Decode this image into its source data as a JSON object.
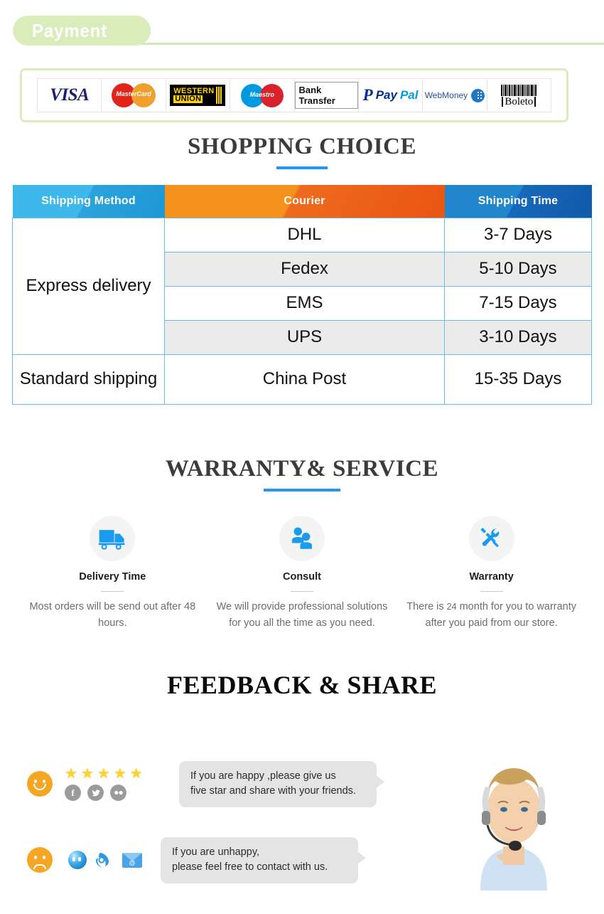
{
  "payment": {
    "banner_label": "Payment",
    "methods": [
      {
        "name": "visa",
        "label": "VISA"
      },
      {
        "name": "mastercard",
        "label": "MasterCard"
      },
      {
        "name": "western-union",
        "label_line1": "WESTERN",
        "label_line2": "UNION"
      },
      {
        "name": "maestro",
        "label": "Maestro"
      },
      {
        "name": "bank-transfer",
        "label": "Bank Transfer"
      },
      {
        "name": "paypal",
        "label_pay": "Pay",
        "label_pal": "Pal"
      },
      {
        "name": "webmoney",
        "label": "WebMoney"
      },
      {
        "name": "boleto",
        "label": "Boleto"
      }
    ]
  },
  "shipping": {
    "title": "SHOPPING CHOICE",
    "columns": [
      "Shipping Method",
      "Courier",
      "Shipping Time"
    ],
    "groups": [
      {
        "method": "Express delivery",
        "rows": [
          {
            "courier": "DHL",
            "time": "3-7  Days"
          },
          {
            "courier": "Fedex",
            "time": "5-10 Days"
          },
          {
            "courier": "EMS",
            "time": "7-15 Days"
          },
          {
            "courier": "UPS",
            "time": "3-10 Days"
          }
        ]
      },
      {
        "method": "Standard shipping",
        "rows": [
          {
            "courier": "China Post",
            "time": "15-35 Days"
          }
        ]
      }
    ]
  },
  "warranty": {
    "title": "WARRANTY& SERVICE",
    "items": [
      {
        "icon": "delivery-truck-icon",
        "name": "Delivery Time",
        "desc": "Most orders will be send out after 48 hours."
      },
      {
        "icon": "consult-people-icon",
        "name": "Consult",
        "desc": "We will provide professional solutions for you all the time as you need."
      },
      {
        "icon": "tools-icon",
        "name": "Warranty",
        "desc_pre": "There is ",
        "desc_num": "24",
        "desc_post": " month for you to warranty after you paid from our store."
      }
    ]
  },
  "feedback": {
    "title": "FEEDBACK & SHARE",
    "happy": {
      "face": "smiley-happy-icon",
      "star_count": 5,
      "star_glyph": "★",
      "socials": [
        {
          "name": "facebook-icon",
          "glyph": "f"
        },
        {
          "name": "twitter-icon",
          "glyph": "ᴠ"
        },
        {
          "name": "flickr-icon",
          "glyph": "••"
        }
      ],
      "line1": "If you are happy ,please give us",
      "line2": "five star and share with your friends."
    },
    "unhappy": {
      "face": "smiley-sad-icon",
      "chat_icons": [
        {
          "name": "aliwangwang-icon"
        },
        {
          "name": "skype-phone-icon",
          "glyph": "✆"
        },
        {
          "name": "email-icon",
          "glyph": "@"
        }
      ],
      "line1": "If you are unhappy,",
      "line2": "please feel free to contact with us."
    },
    "agent_photo_alt": "customer-service-agent-photo"
  },
  "colors": {
    "banner_green": "#dbecbb",
    "accent_blue": "#2196f3",
    "header_light_blue": "#3eb8ea",
    "header_orange": "#f5921e",
    "header_dark_blue": "#2286cd",
    "star_yellow": "#ffd42a",
    "face_orange": "#f5a623"
  }
}
